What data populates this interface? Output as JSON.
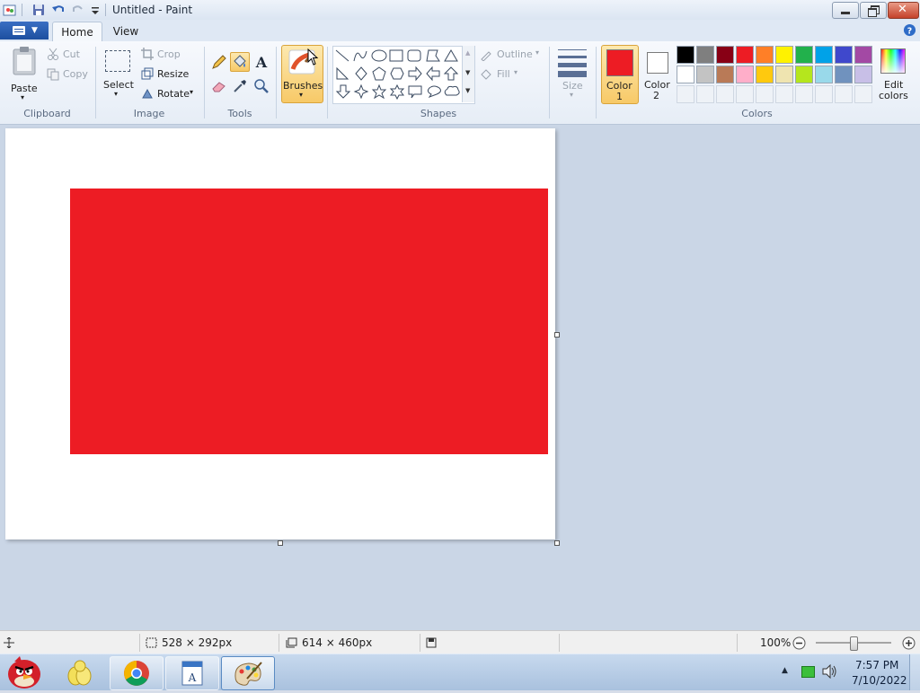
{
  "window": {
    "title": "Untitled - Paint"
  },
  "tabs": {
    "home": "Home",
    "view": "View"
  },
  "clipboard": {
    "paste": "Paste",
    "cut": "Cut",
    "copy": "Copy",
    "group": "Clipboard"
  },
  "image": {
    "select": "Select",
    "crop": "Crop",
    "resize": "Resize",
    "rotate": "Rotate",
    "group": "Image"
  },
  "tools": {
    "group": "Tools"
  },
  "brushes": {
    "label": "Brushes"
  },
  "shapes": {
    "outline": "Outline",
    "fill": "Fill",
    "group": "Shapes"
  },
  "size": {
    "label": "Size"
  },
  "colors": {
    "color1_line1": "Color",
    "color1_line2": "1",
    "color2_line1": "Color",
    "color2_line2": "2",
    "edit_line1": "Edit",
    "edit_line2": "colors",
    "group": "Colors",
    "color1_value": "#ed1c24",
    "color2_value": "#ffffff",
    "row1": [
      "#000000",
      "#7f7f7f",
      "#880015",
      "#ed1c24",
      "#ff7f27",
      "#fff200",
      "#22b14c",
      "#00a2e8",
      "#3f48cc",
      "#a349a4"
    ],
    "row2": [
      "#ffffff",
      "#c3c3c3",
      "#b97a57",
      "#ffaec9",
      "#ffc90e",
      "#efe4b0",
      "#b5e61d",
      "#99d9ea",
      "#7092be",
      "#c8bfe7"
    ]
  },
  "canvas": {
    "rect_color": "#ed1c24",
    "background": "#ffffff"
  },
  "status": {
    "selection_size": "528 × 292px",
    "canvas_size": "614 × 460px",
    "zoom": "100%"
  },
  "taskbar": {
    "time": "7:57 PM",
    "date": "7/10/2022"
  }
}
